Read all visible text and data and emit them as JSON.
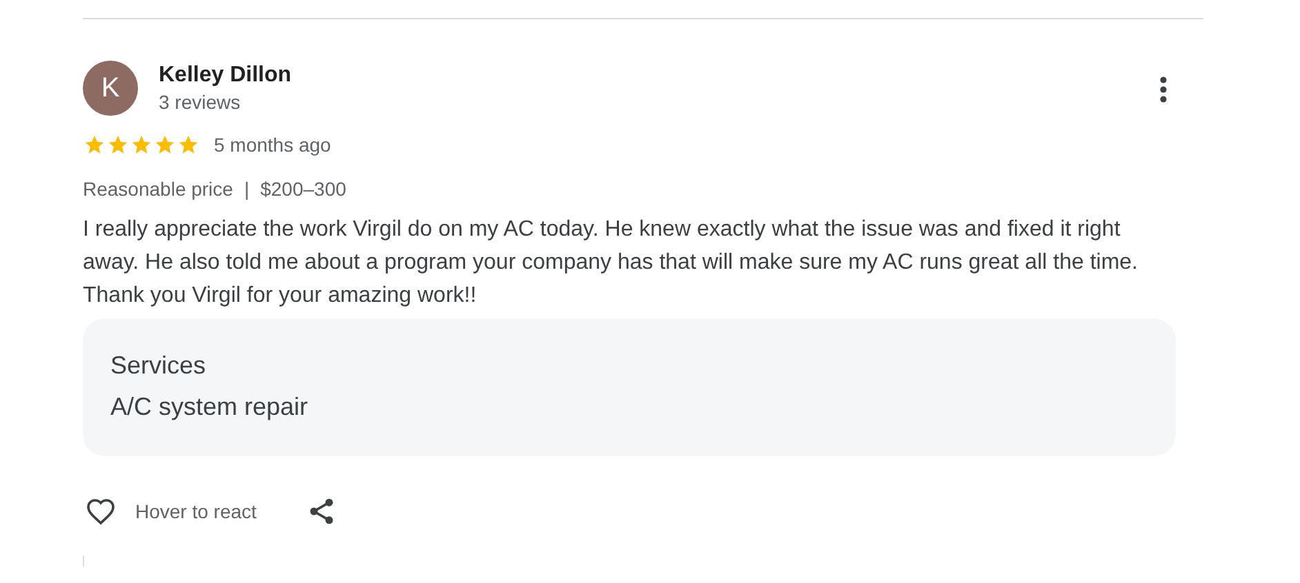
{
  "reviewer": {
    "initial": "K",
    "name": "Kelley Dillon",
    "reviews": "3 reviews"
  },
  "rating": {
    "stars": 5,
    "time": "5 months ago"
  },
  "price": {
    "label": "Reasonable price",
    "separator": "|",
    "value": "$200–300"
  },
  "text": "I really appreciate the work Virgil do on my AC today. He knew exactly what the issue was and fixed it right away. He also told me about a program your company has that will make sure my AC runs great all the time. Thank you Virgil for your amazing work!!",
  "services": {
    "title": "Services",
    "value": "A/C system repair"
  },
  "actions": {
    "react": "Hover to react"
  }
}
